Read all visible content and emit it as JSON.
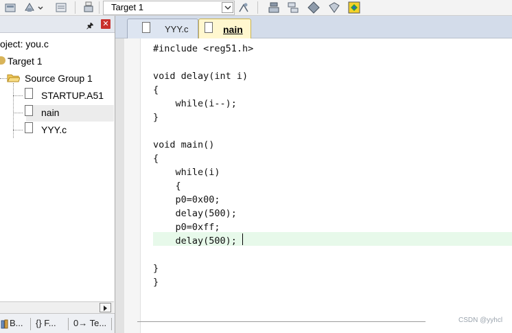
{
  "toolbar": {
    "target_label": "Target 1"
  },
  "project_panel": {
    "project_label": "oject: you.c",
    "target_label": "Target 1",
    "group_label": "Source Group 1",
    "files": [
      "STARTUP.A51",
      "nain",
      "YYY.c"
    ],
    "selected_file": "nain"
  },
  "bottom_tabs": [
    "B...",
    "{} F...",
    "0→ Te..."
  ],
  "editor": {
    "tabs": [
      {
        "label": "YYY.c",
        "active": false
      },
      {
        "label": "nain",
        "active": true
      }
    ],
    "code_lines": [
      "#include <reg51.h>",
      "",
      "void delay(int i)",
      "{",
      "    while(i--);",
      "}",
      "",
      "void main()",
      "{",
      "    while(i)",
      "    {",
      "    p0=0x00;",
      "    delay(500);",
      "    p0=0xff;",
      "    delay(500);",
      "",
      "}",
      "}"
    ],
    "current_line": 15
  },
  "watermark": "CSDN @yyhcl",
  "colors": {
    "tab_strip": "#d3dcea",
    "active_tab": "#fff7cf",
    "current_line_highlight": "#e7f9ea",
    "close_button": "#c9302c"
  }
}
